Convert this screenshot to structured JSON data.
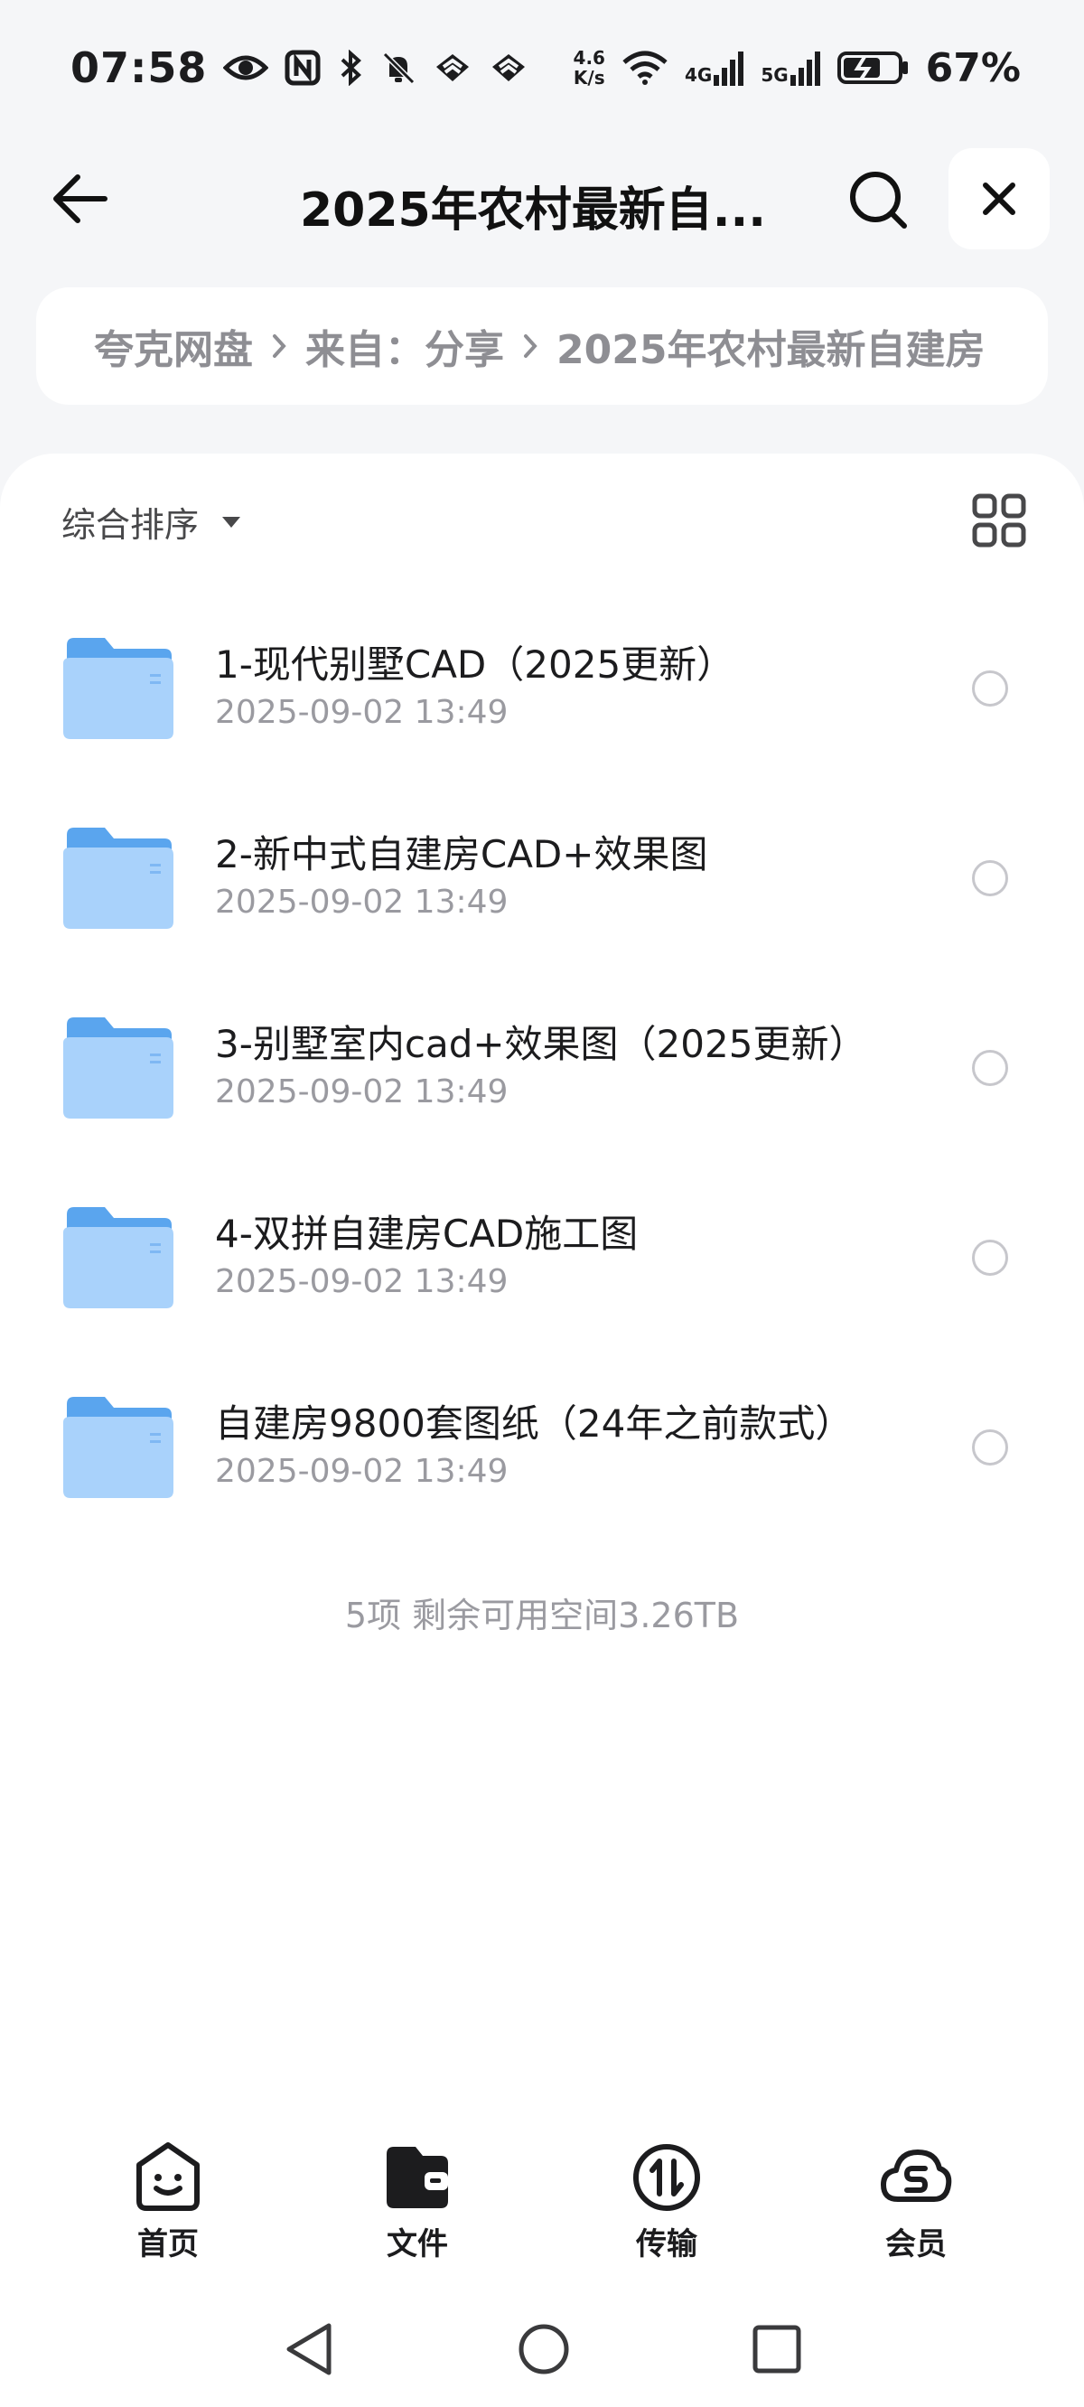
{
  "status_bar": {
    "time": "07:58",
    "speed_value": "4.6",
    "speed_unit": "K/s",
    "net1_label": "4G",
    "net2_label": "5G",
    "battery": "67%"
  },
  "header": {
    "title": "2025年农村最新自..."
  },
  "breadcrumb": {
    "items": [
      "夸克网盘",
      "来自：分享",
      "2025年农村最新自建房"
    ]
  },
  "toolbar": {
    "sort_label": "综合排序"
  },
  "files": [
    {
      "name": "1-现代别墅CAD（2025更新）",
      "date": "2025-09-02 13:49"
    },
    {
      "name": "2-新中式自建房CAD+效果图",
      "date": "2025-09-02 13:49"
    },
    {
      "name": "3-别墅室内cad+效果图（2025更新）",
      "date": "2025-09-02 13:49"
    },
    {
      "name": "4-双拼自建房CAD施工图",
      "date": "2025-09-02 13:49"
    },
    {
      "name": "自建房9800套图纸（24年之前款式）",
      "date": "2025-09-02 13:49"
    }
  ],
  "summary": "5项 剩余可用空间3.26TB",
  "bottom_nav": [
    {
      "label": "首页",
      "icon": "smile-face-icon"
    },
    {
      "label": "文件",
      "icon": "wallet-folder-icon"
    },
    {
      "label": "传输",
      "icon": "transfer-icon"
    },
    {
      "label": "会员",
      "icon": "cloud-s-icon"
    }
  ],
  "colors": {
    "folder_back": "#5aa5ee",
    "folder_front": "#a9d2fb",
    "background": "#f5f6f8"
  }
}
